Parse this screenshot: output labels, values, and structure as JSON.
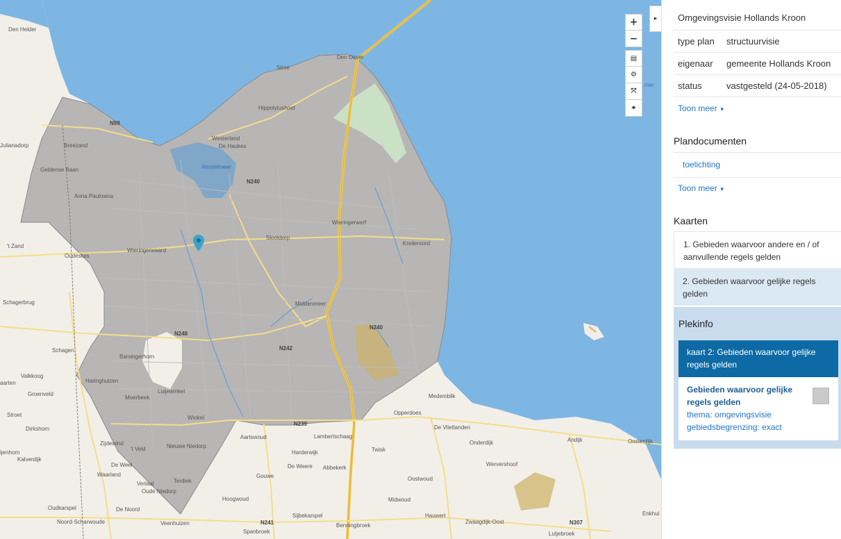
{
  "map": {
    "controls": {
      "zoom_in": "+",
      "zoom_out": "−",
      "layers": "▤",
      "settings": "⚙",
      "fullscreen": "⤧",
      "locate": "⌖"
    },
    "collapse_icon": "▸",
    "water_label": "Amstelmeer",
    "sea_label": "mer",
    "places": {
      "den_helder": "Den Helder",
      "den_oever": "Den Oever",
      "stroe": "Stroe",
      "hippolytushoef": "Hippolytushoef",
      "anna_paulowna_n": "N99",
      "breezand": "Breezand",
      "westerland": "Westerland",
      "de_haukes": "De Haukes",
      "n250": "N240",
      "gelders_baan": "Geldense Baan",
      "anna_paulowna": "Anna Paulowna",
      "julianadorp": "Julianadorp",
      "wieringerwerf": "Wieringerwerf",
      "kreileroord": "Kreileroord",
      "wieringerwaard": "Wieringerwaard",
      "slootdorp": "Slootdorp",
      "t_zand": "'t Zand",
      "oudesluis": "Oudesluis",
      "middenmeer": "Middenmeer",
      "schagerbrug": "Schagerbrug",
      "n248": "N248",
      "n242": "N242",
      "n240b": "N240",
      "schagen": "Schagen",
      "barsingerhorn": "Barsingerhorn",
      "valkkoog": "Valkkoog",
      "haringhuizen": "Haringhuizen",
      "aarten": "aarten",
      "groenveld": "Groenveld",
      "moerbeek": "Moerbeek",
      "lutjewinkel": "Luijewinkel",
      "medemblik": "Medemblik",
      "opperdoes": "Opperdoes",
      "stroet": "Stroet",
      "winkel": "Winkel",
      "n239": "N239",
      "de_vlietlanden": "De Vlietlanden",
      "dirkshorn": "Dirkshorn",
      "zijdewind": "Zijdewind",
      "t_veld": "'t Veld",
      "nieuwe_niedorp": "Nieuwe Niedorp",
      "aartswoud": "Aartswoud",
      "lambertschaag": "Lambertschaag",
      "onderdijk": "Onderdijk",
      "andijk": "Andijk",
      "oosterdijk": "Oosterdijk",
      "ijenhorn": "ijenhorn",
      "kalverdijk": "Kalverdijk",
      "harderwijk": "Harderwijk",
      "twisk": "Twisk",
      "de_weere": "De Weere",
      "abbekerk": "Abbekerk",
      "wervershoof": "Wervershoof",
      "de_weel": "De Weel",
      "waarland": "Waarland",
      "gouwe": "Gouwe",
      "oostwoud": "Oostwoud",
      "verlaat": "Verlaat",
      "terdiek": "Terdiek",
      "oude_niedorp": "Oude Niedorp",
      "hoogwoud": "Hoogwoud",
      "midwoud": "Midwoud",
      "oudkarspel": "Oudkarspel",
      "de_noord": "De Noord",
      "sijbekarspel": "Sijbekarspel",
      "hauwert": "Hauwert",
      "zwaagdijk": "Zwaagdijk-Oost",
      "noord_scharwoude": "Noord-Scharwoude",
      "veenhuizen": "Veenhuizen",
      "n241": "N241",
      "n307": "N307",
      "enkhuizen": "Enkhui",
      "spanbroek": "Spanbroek",
      "benningbroek": "Benningbroek",
      "lutjebroek": "Lutjebroek",
      "stroe2": "Stroe"
    },
    "colors": {
      "sea": "#7db6e3",
      "land": "#f2efe9",
      "plan_area": "#a7a7a7"
    }
  },
  "panel": {
    "plan_title": "Omgevingsvisie Hollands Kroon",
    "properties": [
      {
        "key": "type plan",
        "value": "structuurvisie"
      },
      {
        "key": "eigenaar",
        "value": "gemeente Hollands Kroon"
      },
      {
        "key": "status",
        "value": "vastgesteld (24-05-2018)"
      }
    ],
    "toon_meer_1": "Toon meer",
    "plandocumenten_heading": "Plandocumenten",
    "documents": [
      "toelichting"
    ],
    "toon_meer_2": "Toon meer",
    "kaarten_heading": "Kaarten",
    "kaarten": [
      "1. Gebieden waarvoor andere en / of aanvullende regels gelden",
      "2. Gebieden waarvoor gelijke regels gelden"
    ],
    "plekinfo": {
      "heading": "Plekinfo",
      "header_text": "kaart 2: Gebieden waarvoor gelijke regels gelden",
      "title": "Gebieden waarvoor gelijke regels gelden",
      "lines": [
        "thema: omgevingsvisie",
        "gebiedsbegrenzing: exact"
      ]
    }
  }
}
